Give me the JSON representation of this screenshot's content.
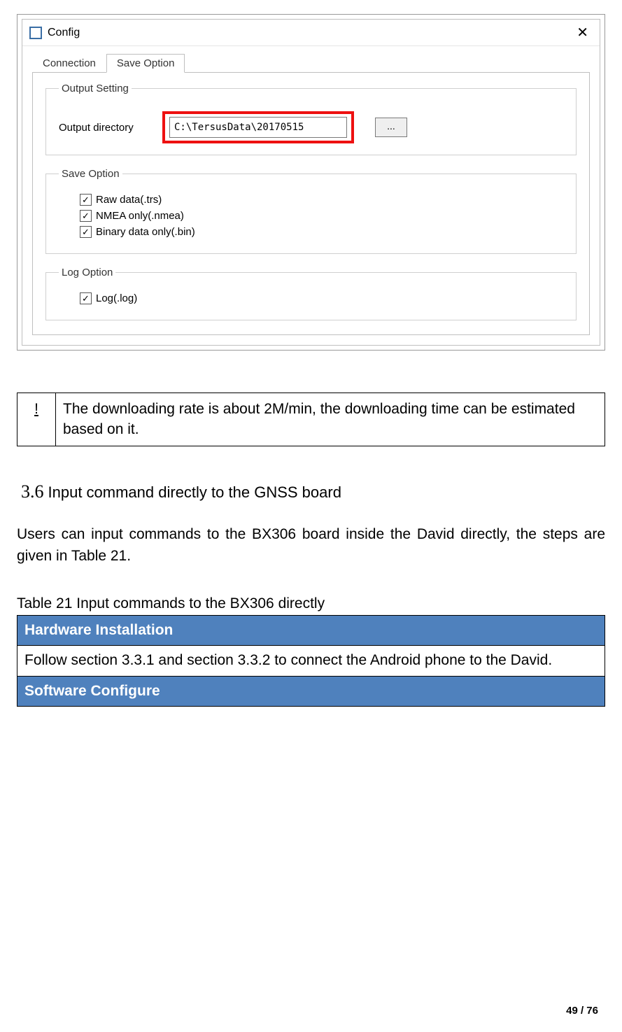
{
  "window": {
    "title": "Config",
    "tabs": {
      "connection": "Connection",
      "save_option": "Save Option"
    },
    "output_setting": {
      "legend": "Output Setting",
      "dir_label": "Output directory",
      "dir_value": "C:\\TersusData\\20170515",
      "browse_label": "..."
    },
    "save_option": {
      "legend": "Save Option",
      "raw": "Raw data(.trs)",
      "nmea": "NMEA only(.nmea)",
      "bin": "Binary data only(.bin)"
    },
    "log_option": {
      "legend": "Log Option",
      "log": "Log(.log)"
    }
  },
  "note": {
    "mark": "!",
    "text": "The downloading rate is about 2M/min, the downloading time can be estimated based on it."
  },
  "section": {
    "number": "3.6",
    "title": "Input command directly to the GNSS board",
    "paragraph": "Users can input commands to the BX306 board inside the David directly, the steps are given in Table 21."
  },
  "table21": {
    "caption": "Table 21 Input commands to the BX306 directly",
    "hw_header": "Hardware Installation",
    "hw_text": "Follow section 3.3.1 and section 3.3.2 to connect the Android phone to the David.",
    "sw_header": "Software Configure"
  },
  "page_number": "49 / 76"
}
